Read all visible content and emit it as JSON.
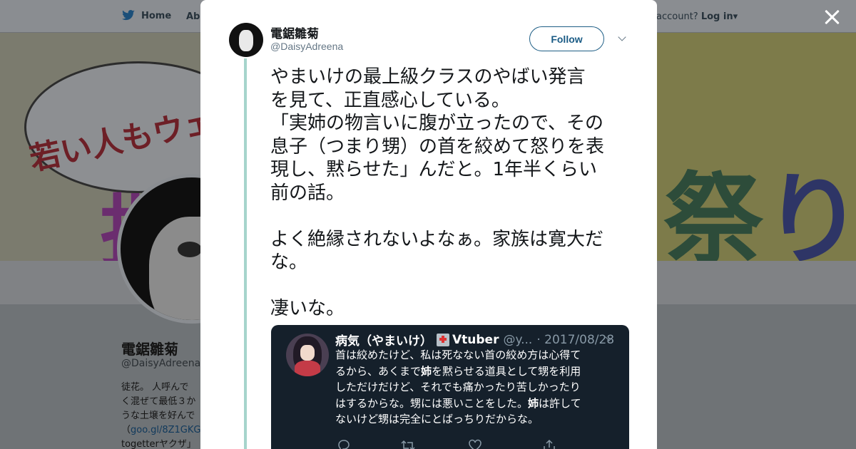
{
  "nav": {
    "home_label": "Home",
    "about_label": "Abo",
    "account_prefix": "account?",
    "login_label": "Log in",
    "login_caret": "▾"
  },
  "banner": {
    "bubble_text": "若い人もウェル",
    "left_char": "批",
    "right_text_a": "祭",
    "right_text_b": "り"
  },
  "profile": {
    "name": "電鋸雛菊",
    "handle": "@DaisyAdreena",
    "bio_line1": "徒花。 人呼んで",
    "bio_line2": "く混ぜて最低３か",
    "bio_line3": "うな土壌を好んで",
    "bio_link": "goo.gl/8Z1GKG",
    "bio_link_prefix": "（",
    "bio_line5": "togetterヤクザ」と"
  },
  "tweet": {
    "author_name": "電鋸雛菊",
    "author_handle": "@DaisyAdreena",
    "follow_label": "Follow",
    "text": "やまいけの最上級クラスのやばい発言\nを見て、正直感心している。\n「実姉の物言いに腹が立ったので、その\n息子（つまり甥）の首を絞めて怒りを表\n現し、黙らせた」んだと。1年半くらい\n前の話。\n\nよく絶縁されないよなぁ。家族は寛大だ\nな。\n\n凄いな。"
  },
  "quote": {
    "name": "病気（やまいけ）",
    "badge": "Vtuber",
    "handle": "@y...",
    "date": "· 2017/08/28",
    "line1": "首は絞めたけど、私は死なない首の絞め方は心得て",
    "line2a": "るから、あくまで",
    "line2b": "姉",
    "line2c": "を黙らせる道具として甥を利用",
    "line3": "しただけだけど、それでも痛かったり苦しかったり",
    "line4a": "はするからな。甥には悪いことをした。",
    "line4b": "姉",
    "line4c": "は許して",
    "line5": "ないけど甥は完全にとばっちりだからな。"
  },
  "colors": {
    "accent": "#1da1f2",
    "overlay": "#7a7f84",
    "thread_line": "#a6d4cc",
    "quote_bg": "#15202b"
  },
  "icons": [
    "twitter-bird-icon",
    "close-icon",
    "caret-down-icon",
    "reply-icon",
    "retweet-icon",
    "like-icon",
    "share-icon",
    "hospital-icon"
  ]
}
